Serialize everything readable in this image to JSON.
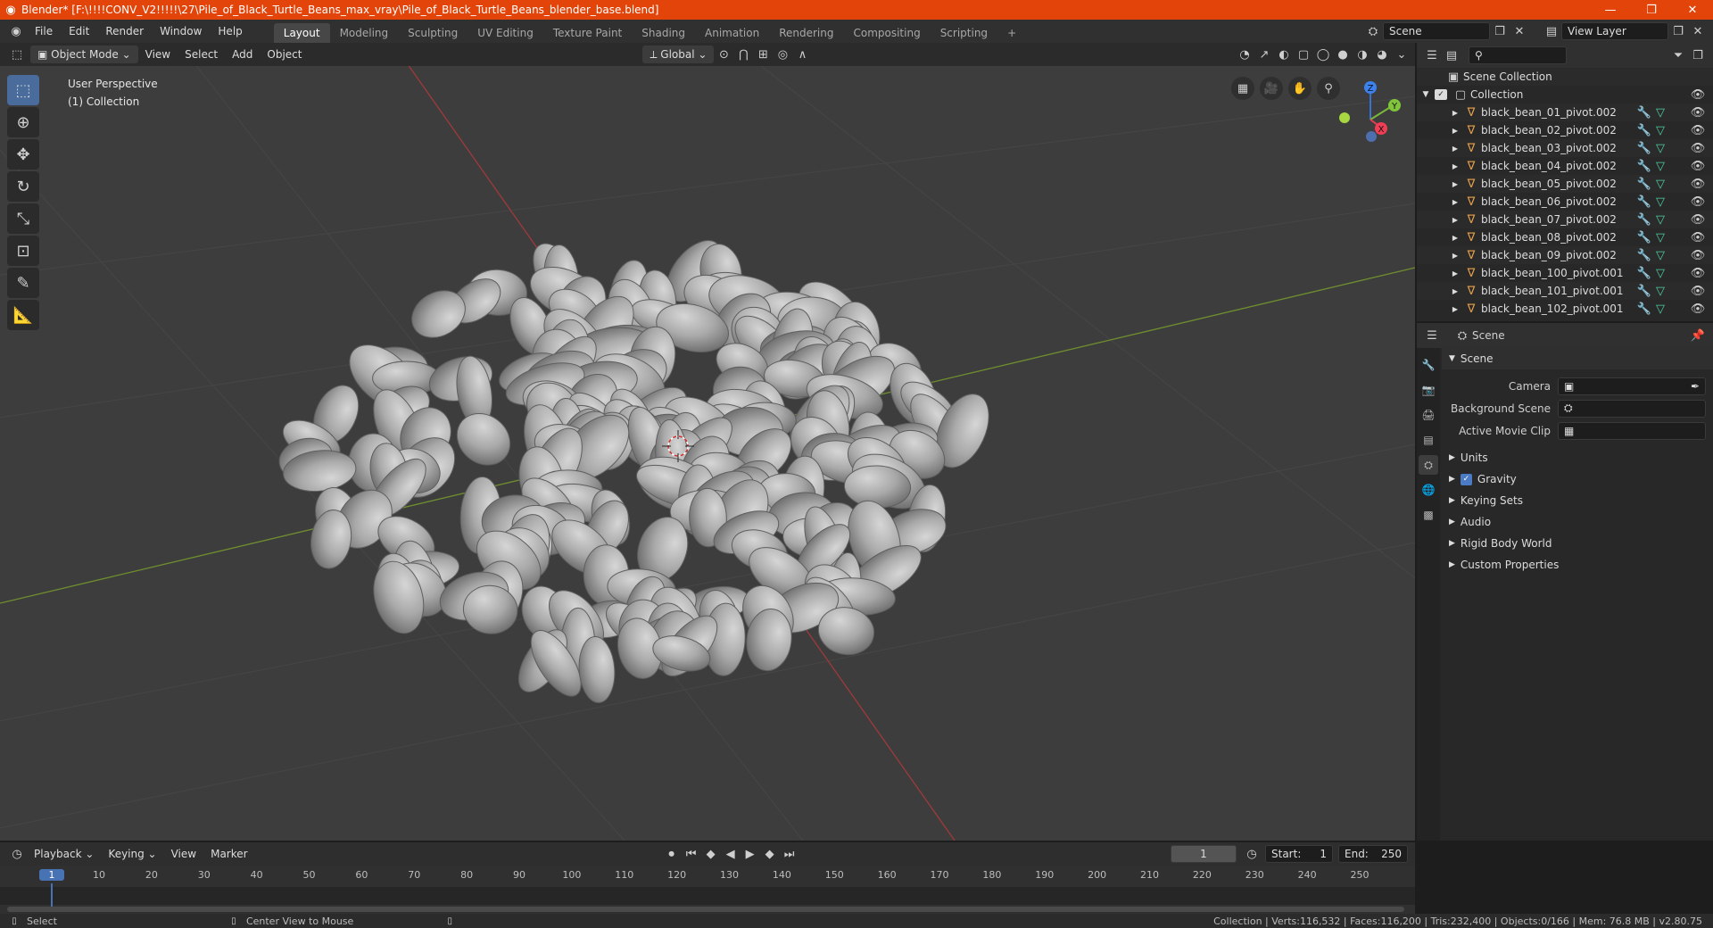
{
  "title_bar": {
    "title": "Blender* [F:\\!!!!CONV_V2!!!!!\\27\\Pile_of_Black_Turtle_Beans_max_vray\\Pile_of_Black_Turtle_Beans_blender_base.blend]",
    "minimize": "—",
    "maximize": "❐",
    "close": "✕"
  },
  "menu": [
    "File",
    "Edit",
    "Render",
    "Window",
    "Help"
  ],
  "workspaces": [
    "Layout",
    "Modeling",
    "Sculpting",
    "UV Editing",
    "Texture Paint",
    "Shading",
    "Animation",
    "Rendering",
    "Compositing",
    "Scripting"
  ],
  "workspace_active": "Layout",
  "add_workspace": "+",
  "scene_field": "Scene",
  "view_layer_field": "View Layer",
  "viewport_header": {
    "mode": "Object Mode",
    "menus": [
      "View",
      "Select",
      "Add",
      "Object"
    ],
    "transform_orientation": "Global"
  },
  "viewport": {
    "perspective_label": "User Perspective",
    "collection_label": "(1) Collection",
    "axes": {
      "x": "X",
      "y": "Y",
      "z": "Z"
    }
  },
  "outliner": {
    "root": "Scene Collection",
    "collection": "Collection",
    "items": [
      "black_bean_01_pivot.002",
      "black_bean_02_pivot.002",
      "black_bean_03_pivot.002",
      "black_bean_04_pivot.002",
      "black_bean_05_pivot.002",
      "black_bean_06_pivot.002",
      "black_bean_07_pivot.002",
      "black_bean_08_pivot.002",
      "black_bean_09_pivot.002",
      "black_bean_100_pivot.001",
      "black_bean_101_pivot.001",
      "black_bean_102_pivot.001"
    ]
  },
  "properties": {
    "header": "Scene",
    "section": "Scene",
    "camera_label": "Camera",
    "background_scene_label": "Background Scene",
    "active_movie_clip_label": "Active Movie Clip",
    "panels": [
      "Units",
      "Gravity",
      "Keying Sets",
      "Audio",
      "Rigid Body World",
      "Custom Properties"
    ],
    "gravity_checked": true
  },
  "timeline": {
    "menus": [
      "Playback",
      "Keying",
      "View",
      "Marker"
    ],
    "current_frame": "1",
    "start_label": "Start:",
    "start_value": "1",
    "end_label": "End:",
    "end_value": "250",
    "ruler": [
      "1",
      "10",
      "20",
      "30",
      "40",
      "50",
      "60",
      "70",
      "80",
      "90",
      "100",
      "110",
      "120",
      "130",
      "140",
      "150",
      "160",
      "170",
      "180",
      "190",
      "200",
      "210",
      "220",
      "230",
      "240",
      "250"
    ]
  },
  "status_bar": {
    "left_action": "Select",
    "middle_action": "Center View to Mouse",
    "stats": "Collection | Verts:116,532 | Faces:116,200 | Tris:232,400 | Objects:0/166 | Mem: 76.8 MB | v2.80.75"
  }
}
